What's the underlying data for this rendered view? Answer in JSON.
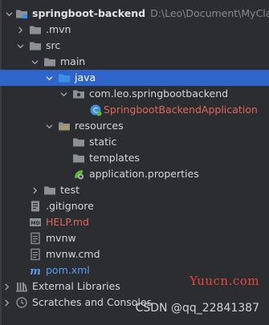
{
  "project": {
    "name": "springboot-backend",
    "path": "D:\\Leo\\Document\\MyClass\\S"
  },
  "tree": {
    "mvn": ".mvn",
    "src": "src",
    "main": "main",
    "java": "java",
    "package": "com.leo.springbootbackend",
    "app_class": "SpringbootBackendApplication",
    "resources": "resources",
    "static": "static",
    "templates": "templates",
    "app_props": "application.properties",
    "test": "test",
    "gitignore": ".gitignore",
    "help": "HELP.md",
    "mvnw": "mvnw",
    "mvnw_cmd": "mvnw.cmd",
    "pom": "pom.xml",
    "ext_libs": "External Libraries",
    "scratches": "Scratches and Consoles"
  },
  "watermark": {
    "site": "Yuucn.com",
    "author": "CSDN @qq_22841387"
  },
  "colors": {
    "background": "#2b2d30",
    "selection": "#2f65ca",
    "folder": "#8b9096",
    "source_folder": "#3d8fe5",
    "resource_folder": "#c79f32",
    "modified_text": "#e0675d",
    "xml_text": "#5a9bf6"
  }
}
